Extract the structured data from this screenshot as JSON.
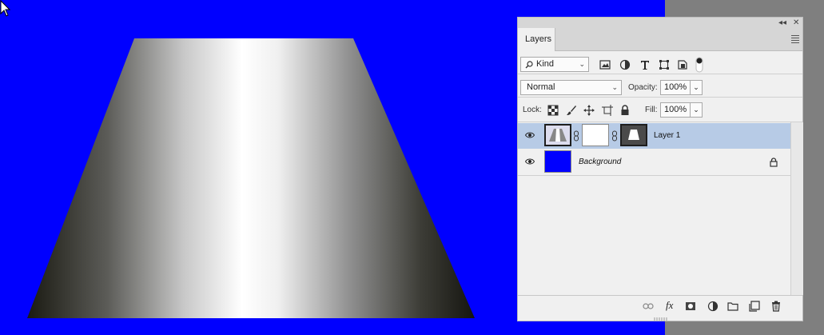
{
  "panel": {
    "tab_label": "Layers",
    "collapse_glyph": "◂◂",
    "close_glyph": "✕",
    "filter": {
      "value": "Kind",
      "icons": [
        "image-filter-icon",
        "adjustment-filter-icon",
        "type-filter-icon",
        "shape-filter-icon",
        "smart-object-filter-icon",
        "filter-toggle-icon"
      ]
    },
    "blend_mode": "Normal",
    "opacity_label": "Opacity:",
    "opacity_value": "100%",
    "lock_label": "Lock:",
    "fill_label": "Fill:",
    "fill_value": "100%",
    "layers": [
      {
        "name": "Layer 1",
        "selected": true,
        "visible": true
      },
      {
        "name": "Background",
        "selected": false,
        "visible": true,
        "locked": true
      }
    ],
    "footer_icons": [
      "link-layers-icon",
      "fx-icon",
      "add-mask-icon",
      "adjustment-layer-icon",
      "new-group-icon",
      "new-layer-icon",
      "delete-layer-icon"
    ],
    "fx_label": "fx"
  },
  "colors": {
    "canvas_bg": "#0000ff",
    "selected_row": "#b7cbe6",
    "background_thumb": "#0000ff"
  }
}
